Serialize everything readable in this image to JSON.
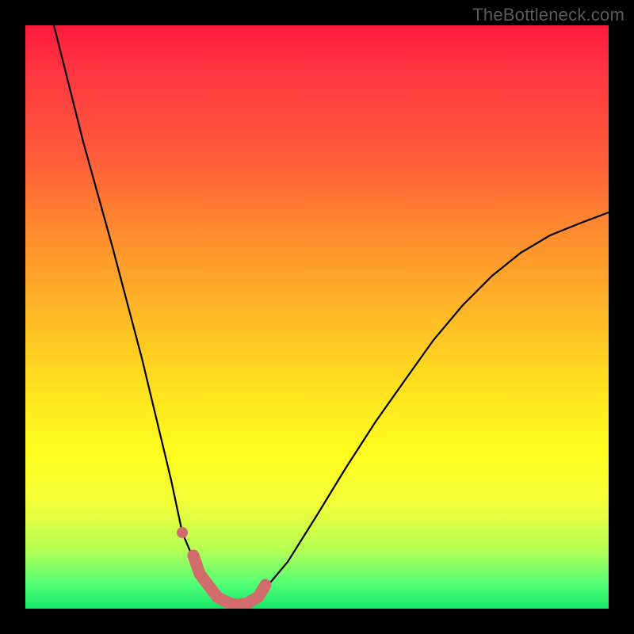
{
  "watermark": "TheBottleneck.com",
  "colors": {
    "background_frame": "#000000",
    "gradient_top": "#ff1a3c",
    "gradient_mid": "#ffe11f",
    "gradient_bottom": "#17e86a",
    "curve_stroke": "#000000",
    "highlight_stroke": "#d26c6c"
  },
  "chart_data": {
    "type": "line",
    "title": "",
    "xlabel": "",
    "ylabel": "",
    "xlim": [
      0,
      100
    ],
    "ylim": [
      0,
      100
    ],
    "series": [
      {
        "name": "bottleneck-curve",
        "x": [
          5,
          10,
          15,
          20,
          25,
          27,
          30,
          33,
          35,
          38,
          40,
          45,
          50,
          55,
          60,
          65,
          70,
          75,
          80,
          85,
          90,
          95,
          100
        ],
        "values": [
          100,
          80,
          62,
          43,
          22,
          13,
          6,
          2,
          1,
          1,
          2,
          8,
          16,
          24,
          32,
          39,
          46,
          52,
          57,
          61,
          64,
          66,
          68
        ]
      }
    ],
    "highlight": {
      "name": "bottom-segment",
      "x": [
        27,
        30,
        33,
        35,
        38,
        40
      ],
      "values": [
        13,
        6,
        2,
        1,
        1,
        2
      ]
    }
  }
}
